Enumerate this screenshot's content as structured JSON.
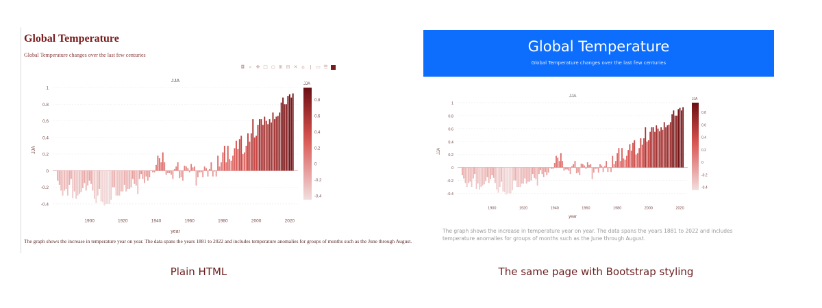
{
  "left": {
    "title": "Global Temperature",
    "subtitle": "Global Temperature changes over the last few centuries",
    "toolbar_icons": [
      "camera-icon",
      "zoom-icon",
      "pan-icon",
      "select-box-icon",
      "lasso-icon",
      "zoom-in-icon",
      "zoom-out-icon",
      "autoscale-icon",
      "reset-axes-icon",
      "spike-lines-icon",
      "hover-closest-icon",
      "hover-compare-icon",
      "plotly-logo-icon"
    ],
    "caption": "The graph shows the increase in temperature year on year. The data spans the years 1881 to 2022 and includes temperature anomalies for groups of months such as the June through August."
  },
  "right": {
    "title": "Global Temperature",
    "subtitle": "Global Temperature changes over the last few centuries",
    "caption": "The graph shows the increase in temperature year on year. The data spans the years 1881 to 2022 and includes temperature anomalies for groups of months such as the June through August."
  },
  "labels": {
    "plain": "Plain HTML",
    "bootstrap": "The same page with Bootstrap styling"
  },
  "colors": {
    "bootstrap_blue": "#0d6efd",
    "bar_low": "#f2dede",
    "bar_mid": "#d9534f",
    "bar_high": "#6b0f12",
    "title_maroon": "#7a1c1c"
  },
  "chart_data": {
    "type": "bar",
    "title": "JJA",
    "xlabel": "year",
    "ylabel": "JJA",
    "colorbar_title": "JJA",
    "xlim": [
      1878,
      2025
    ],
    "ylim": [
      -0.5,
      1.0
    ],
    "x_ticks": [
      1900,
      1920,
      1940,
      1960,
      1980,
      2000,
      2020
    ],
    "y_ticks": [
      -0.4,
      -0.2,
      0,
      0.2,
      0.4,
      0.6,
      0.8,
      1
    ],
    "colorbar_ticks": [
      -0.4,
      -0.2,
      0,
      0.2,
      0.4,
      0.6,
      0.8
    ],
    "x": [
      1881,
      1882,
      1883,
      1884,
      1885,
      1886,
      1887,
      1888,
      1889,
      1890,
      1891,
      1892,
      1893,
      1894,
      1895,
      1896,
      1897,
      1898,
      1899,
      1900,
      1901,
      1902,
      1903,
      1904,
      1905,
      1906,
      1907,
      1908,
      1909,
      1910,
      1911,
      1912,
      1913,
      1914,
      1915,
      1916,
      1917,
      1918,
      1919,
      1920,
      1921,
      1922,
      1923,
      1924,
      1925,
      1926,
      1927,
      1928,
      1929,
      1930,
      1931,
      1932,
      1933,
      1934,
      1935,
      1936,
      1937,
      1938,
      1939,
      1940,
      1941,
      1942,
      1943,
      1944,
      1945,
      1946,
      1947,
      1948,
      1949,
      1950,
      1951,
      1952,
      1953,
      1954,
      1955,
      1956,
      1957,
      1958,
      1959,
      1960,
      1961,
      1962,
      1963,
      1964,
      1965,
      1966,
      1967,
      1968,
      1969,
      1970,
      1971,
      1972,
      1973,
      1974,
      1975,
      1976,
      1977,
      1978,
      1979,
      1980,
      1981,
      1982,
      1983,
      1984,
      1985,
      1986,
      1987,
      1988,
      1989,
      1990,
      1991,
      1992,
      1993,
      1994,
      1995,
      1996,
      1997,
      1998,
      1999,
      2000,
      2001,
      2002,
      2003,
      2004,
      2005,
      2006,
      2007,
      2008,
      2009,
      2010,
      2011,
      2012,
      2013,
      2014,
      2015,
      2016,
      2017,
      2018,
      2019,
      2020,
      2021,
      2022
    ],
    "values": [
      -0.12,
      -0.17,
      -0.24,
      -0.3,
      -0.24,
      -0.22,
      -0.3,
      -0.17,
      -0.1,
      -0.33,
      -0.25,
      -0.34,
      -0.3,
      -0.28,
      -0.26,
      -0.21,
      -0.15,
      -0.24,
      -0.18,
      -0.12,
      -0.16,
      -0.24,
      -0.34,
      -0.39,
      -0.3,
      -0.22,
      -0.37,
      -0.38,
      -0.42,
      -0.4,
      -0.4,
      -0.4,
      -0.35,
      -0.2,
      -0.2,
      -0.3,
      -0.3,
      -0.3,
      -0.25,
      -0.25,
      -0.17,
      -0.25,
      -0.22,
      -0.22,
      -0.2,
      -0.1,
      -0.16,
      -0.18,
      -0.28,
      -0.1,
      -0.04,
      -0.1,
      -0.15,
      -0.07,
      -0.12,
      -0.08,
      0.0,
      -0.02,
      -0.02,
      0.07,
      0.18,
      0.15,
      0.1,
      0.22,
      0.1,
      -0.05,
      -0.03,
      -0.03,
      -0.05,
      -0.1,
      0.02,
      0.05,
      0.1,
      -0.09,
      -0.08,
      -0.12,
      0.06,
      0.05,
      0.03,
      -0.02,
      0.08,
      0.04,
      0.05,
      -0.18,
      -0.08,
      -0.02,
      -0.02,
      -0.08,
      0.05,
      0.03,
      -0.07,
      0.02,
      0.1,
      -0.07,
      -0.01,
      -0.07,
      0.18,
      0.05,
      0.1,
      0.22,
      0.3,
      0.1,
      0.3,
      0.14,
      0.12,
      0.18,
      0.27,
      0.36,
      0.26,
      0.38,
      0.42,
      0.2,
      0.22,
      0.3,
      0.45,
      0.35,
      0.45,
      0.62,
      0.4,
      0.42,
      0.55,
      0.62,
      0.62,
      0.55,
      0.65,
      0.6,
      0.56,
      0.62,
      0.58,
      0.7,
      0.62,
      0.65,
      0.66,
      0.7,
      0.82,
      0.88,
      0.8,
      0.8,
      0.9,
      0.92,
      0.88,
      0.93
    ]
  }
}
